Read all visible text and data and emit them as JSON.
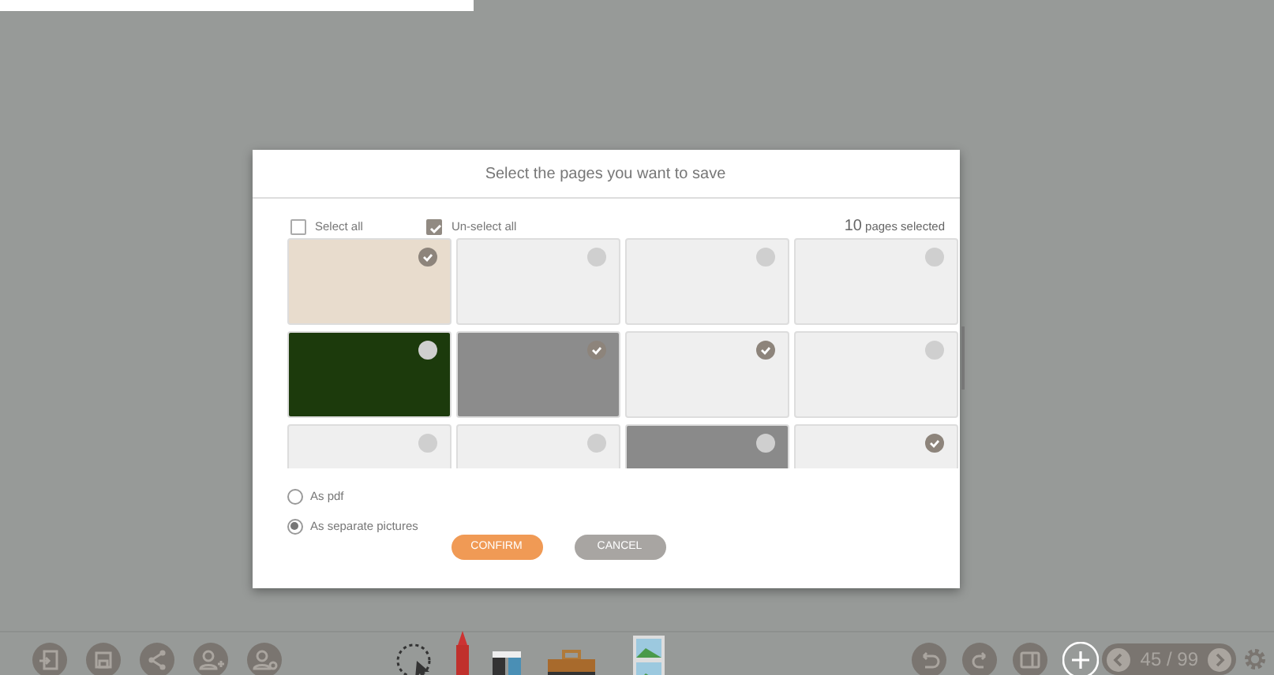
{
  "dialog": {
    "title": "Select the pages you want to save",
    "select_all": {
      "label": "Select all",
      "checked": false
    },
    "unselect_all": {
      "label": "Un-select all",
      "checked": true
    },
    "count": "10",
    "count_label": "pages selected",
    "pages": [
      {
        "color": "#e8dccd",
        "selected": true
      },
      {
        "color": "#efefef",
        "selected": false
      },
      {
        "color": "#efefef",
        "selected": false
      },
      {
        "color": "#efefef",
        "selected": false
      },
      {
        "color": "#1c3a0c",
        "selected": false
      },
      {
        "color": "#8c8c8c",
        "selected": true
      },
      {
        "color": "#efefef",
        "selected": true
      },
      {
        "color": "#efefef",
        "selected": false
      },
      {
        "color": "#efefef",
        "selected": false
      },
      {
        "color": "#efefef",
        "selected": false
      },
      {
        "color": "#8a8a8a",
        "selected": false
      },
      {
        "color": "#efefef",
        "selected": true
      }
    ],
    "formats": [
      {
        "label": "As pdf",
        "selected": false
      },
      {
        "label": "As separate pictures",
        "selected": true
      }
    ],
    "buttons": [
      {
        "label": "CONFIRM",
        "kind": "primary"
      },
      {
        "label": "CANCEL",
        "kind": "secondary"
      }
    ]
  },
  "toolbar": {
    "left": [
      {
        "kind": "exit"
      },
      {
        "kind": "save"
      },
      {
        "kind": "share"
      },
      {
        "kind": "adduser"
      },
      {
        "kind": "usersettings"
      }
    ],
    "tools": [
      {
        "kind": "lasso"
      },
      {
        "kind": "pen"
      },
      {
        "kind": "markers"
      },
      {
        "kind": "briefcase"
      },
      {
        "kind": "pictures"
      }
    ],
    "right": [
      {
        "kind": "undo"
      },
      {
        "kind": "redo"
      },
      {
        "kind": "screen"
      },
      {
        "kind": "add"
      }
    ],
    "pager": "45 / 99"
  }
}
